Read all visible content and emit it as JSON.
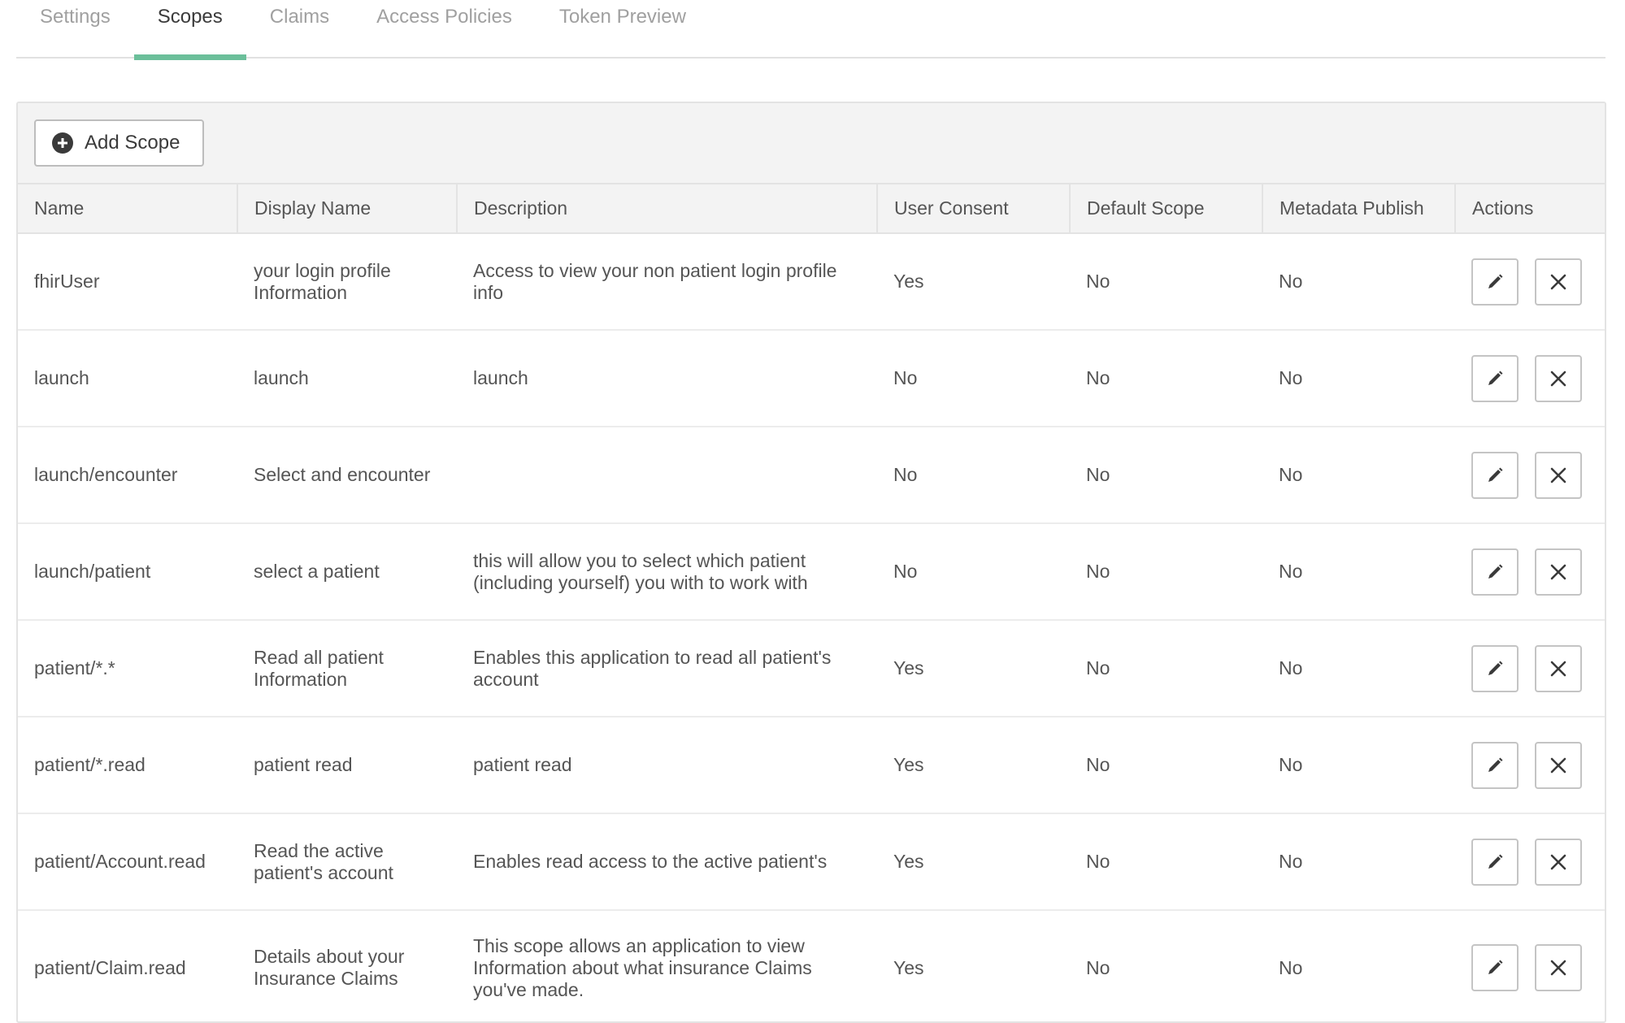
{
  "tabs": [
    {
      "label": "Settings",
      "active": false
    },
    {
      "label": "Scopes",
      "active": true
    },
    {
      "label": "Claims",
      "active": false
    },
    {
      "label": "Access Policies",
      "active": false
    },
    {
      "label": "Token Preview",
      "active": false
    }
  ],
  "toolbar": {
    "add_label": "Add Scope",
    "add_icon": "plus-circle-icon"
  },
  "table": {
    "columns": [
      "Name",
      "Display Name",
      "Description",
      "User Consent",
      "Default Scope",
      "Metadata Publish",
      "Actions"
    ],
    "rows": [
      {
        "name": "fhirUser",
        "display": "your login profile Information",
        "description": "Access to view your non patient login profile info",
        "consent": "Yes",
        "default": "No",
        "publish": "No"
      },
      {
        "name": "launch",
        "display": "launch",
        "description": "launch",
        "consent": "No",
        "default": "No",
        "publish": "No"
      },
      {
        "name": "launch/encounter",
        "display": "Select and encounter",
        "description": "",
        "consent": "No",
        "default": "No",
        "publish": "No"
      },
      {
        "name": "launch/patient",
        "display": "select a patient",
        "description": "this will allow you to select which patient (including yourself) you with to work with",
        "consent": "No",
        "default": "No",
        "publish": "No"
      },
      {
        "name": "patient/*.*",
        "display": "Read all patient Information",
        "description": "Enables this application to read all patient's account",
        "consent": "Yes",
        "default": "No",
        "publish": "No"
      },
      {
        "name": "patient/*.read",
        "display": "patient read",
        "description": "patient read",
        "consent": "Yes",
        "default": "No",
        "publish": "No"
      },
      {
        "name": "patient/Account.read",
        "display": "Read the active patient's account",
        "description": "Enables read access to the active patient's",
        "consent": "Yes",
        "default": "No",
        "publish": "No"
      },
      {
        "name": "patient/Claim.read",
        "display": "Details about your Insurance Claims",
        "description": "This scope allows an application to view Information about what insurance Claims you've made.",
        "consent": "Yes",
        "default": "No",
        "publish": "No"
      }
    ],
    "row_actions": {
      "edit_icon": "pencil-icon",
      "delete_icon": "close-icon"
    }
  },
  "colors": {
    "accent": "#6bbf9a",
    "header_bg": "#f3f3f3",
    "border": "#e3e3e3"
  }
}
